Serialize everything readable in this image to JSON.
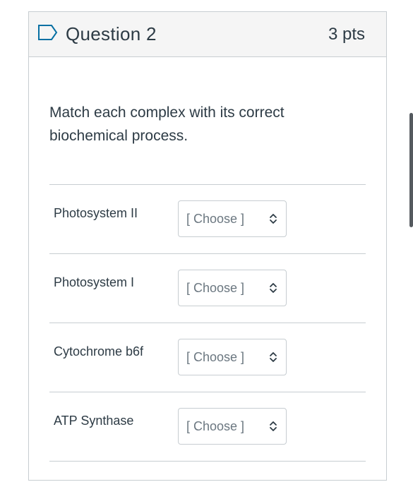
{
  "question": {
    "title": "Question 2",
    "points": "3 pts",
    "prompt": "Match each complex with its correct biochemical process."
  },
  "matches": [
    {
      "label": "Photosystem II",
      "selected": "[ Choose ]"
    },
    {
      "label": "Photosystem I",
      "selected": "[ Choose ]"
    },
    {
      "label": "Cytochrome b6f",
      "selected": "[ Choose ]"
    },
    {
      "label": "ATP Synthase",
      "selected": "[ Choose ]"
    }
  ],
  "colors": {
    "accent": "#0770a3",
    "text": "#2d3b45",
    "border": "#c7cdd1",
    "header_bg": "#f5f5f5"
  },
  "icons": [
    "flag-icon",
    "select-arrows-icon"
  ]
}
